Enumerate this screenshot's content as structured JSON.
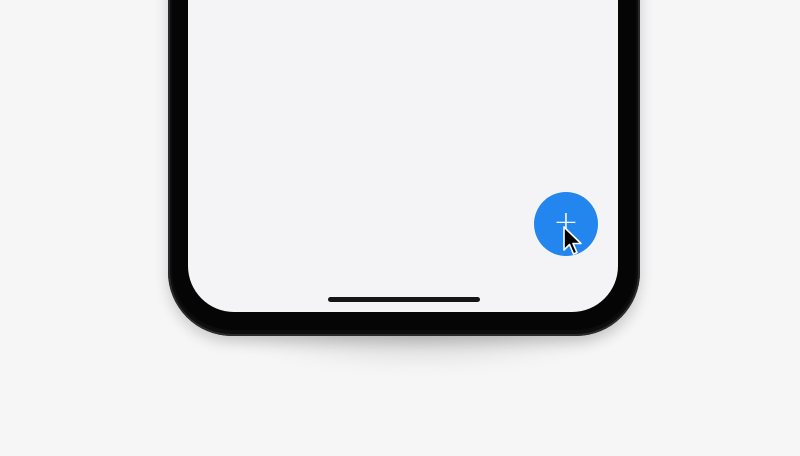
{
  "fab": {
    "label": "+",
    "color": "#2386ef"
  },
  "screen": {
    "background": "#f4f4f6"
  },
  "icons": {
    "cursor": "mouse-pointer-icon"
  }
}
